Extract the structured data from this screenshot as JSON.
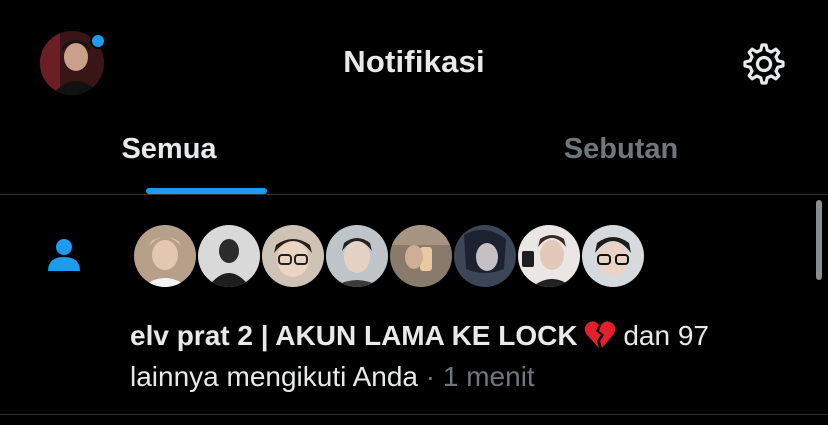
{
  "header": {
    "title": "Notifikasi",
    "avatar_icon": "profile-avatar",
    "settings_icon": "gear-icon",
    "has_unread_dot": true
  },
  "tabs": [
    {
      "label": "Semua",
      "selected": true
    },
    {
      "label": "Sebutan",
      "selected": false
    }
  ],
  "notification": {
    "icon": "person-icon",
    "follower_avatars_count": 8,
    "name": "elv prat 2 | AKUN LAMA KE LOCK",
    "emoji": "broken-heart",
    "and_others": "dan 97",
    "action": "lainnya mengikuti Anda",
    "separator": "·",
    "time": "1 menit"
  },
  "colors": {
    "accent": "#1d9bf0",
    "background": "#000000",
    "primary_text": "#e7e9ea",
    "secondary_text": "#71767b",
    "divider": "#2f3336"
  }
}
